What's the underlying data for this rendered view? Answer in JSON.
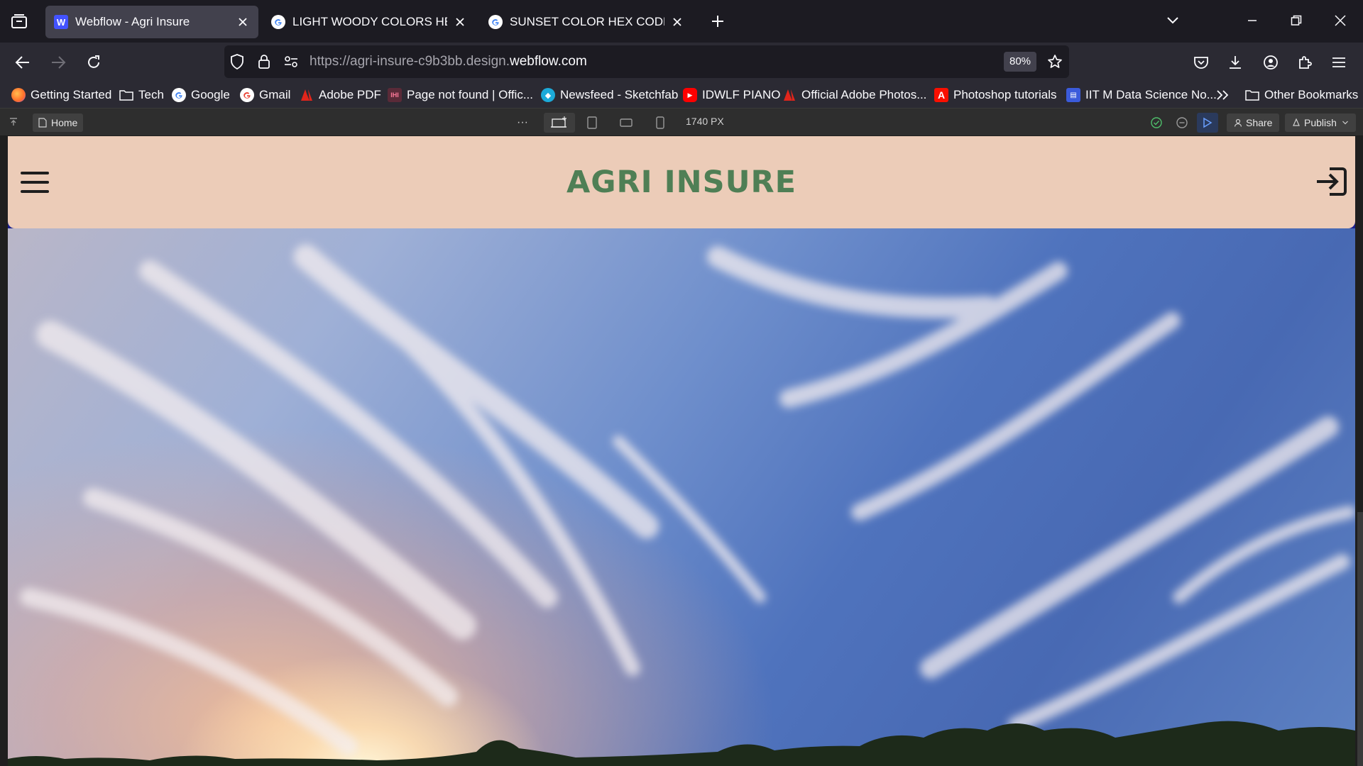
{
  "browser": {
    "tabs": [
      {
        "title": "Webflow - Agri Insure",
        "active": true,
        "favicon": "webflow-icon"
      },
      {
        "title": "LIGHT WOODY COLORS HEX CODE",
        "active": false,
        "favicon": "google-icon"
      },
      {
        "title": "SUNSET COLOR HEX CODE - Google",
        "active": false,
        "favicon": "google-icon"
      }
    ],
    "url_prefix": "https://agri-insure-c9b3bb.design.",
    "url_domain": "webflow.com",
    "zoom": "80%",
    "bookmarks": [
      {
        "label": "Getting Started",
        "icon": "firefox-icon"
      },
      {
        "label": "Tech",
        "icon": "folder-icon"
      },
      {
        "label": "Google",
        "icon": "google-icon"
      },
      {
        "label": "Gmail",
        "icon": "google-icon"
      },
      {
        "label": "Adobe PDF",
        "icon": "adobe-icon"
      },
      {
        "label": "Page not found | Offic...",
        "icon": "page-icon"
      },
      {
        "label": "Newsfeed - Sketchfab",
        "icon": "sketchfab-icon"
      },
      {
        "label": "IDWLF PIANO",
        "icon": "youtube-icon"
      },
      {
        "label": "Official Adobe Photos...",
        "icon": "adobe-icon"
      },
      {
        "label": "Photoshop tutorials",
        "icon": "adobe-a-icon"
      },
      {
        "label": "IIT M Data Science No...",
        "icon": "iitm-icon"
      }
    ],
    "other_bookmarks": "Other Bookmarks"
  },
  "webflow": {
    "page_label": "Home",
    "more": "···",
    "canvas_width": "1740 PX",
    "share_label": "Share",
    "publish_label": "Publish"
  },
  "site": {
    "title": "AGRI INSURE"
  },
  "colors": {
    "header_bg": "#ecccb8",
    "title_green": "#4f7f55",
    "webflow_blue": "#4353ff"
  }
}
